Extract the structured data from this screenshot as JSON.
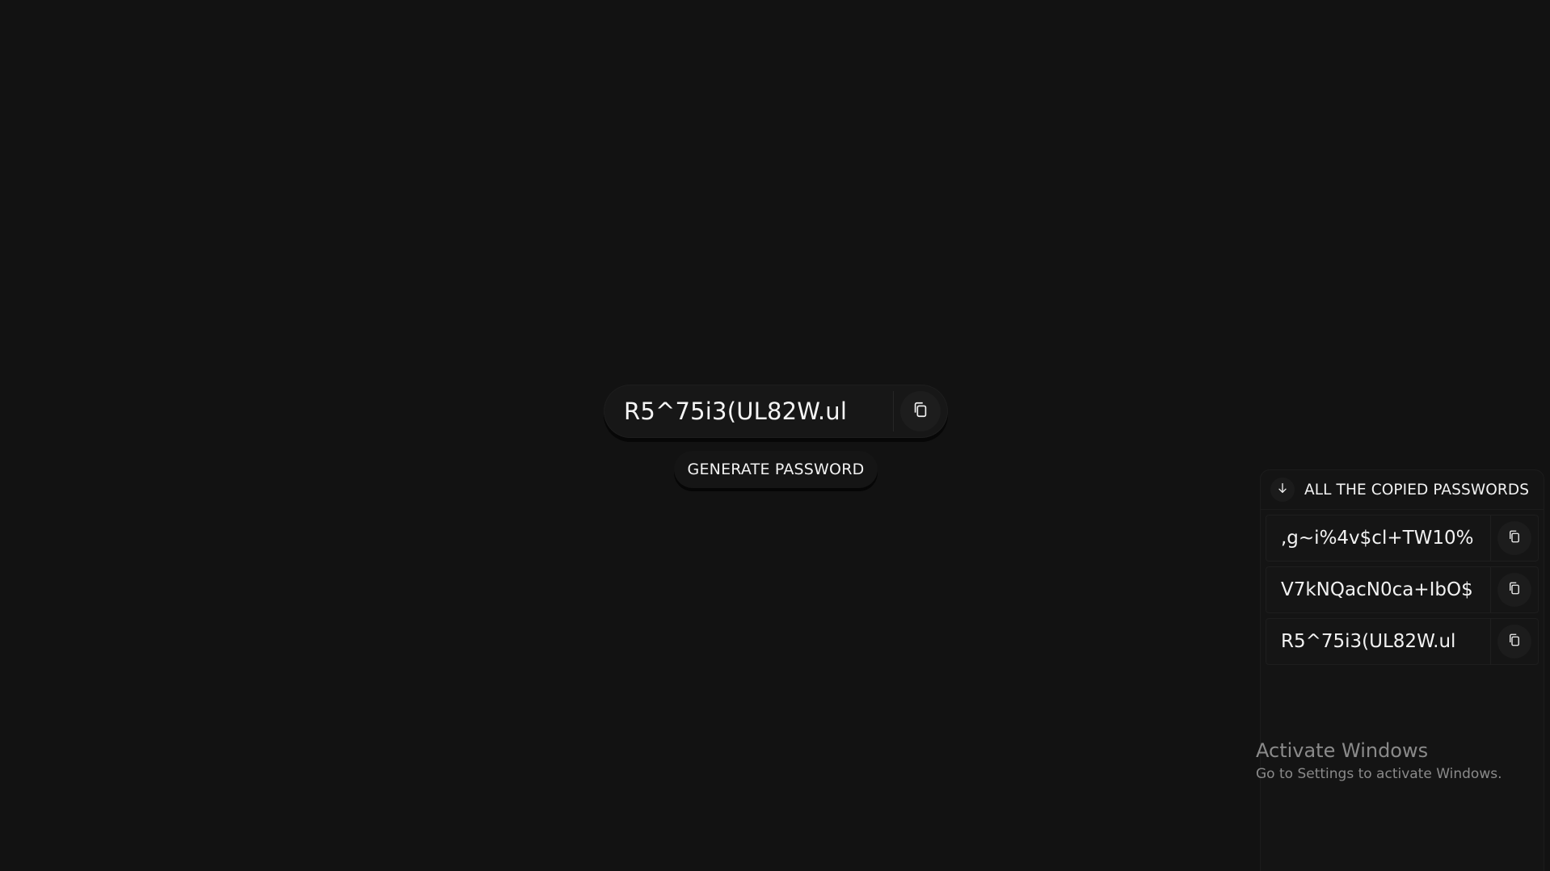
{
  "main": {
    "password": "R5^75i3(UL82W.ul",
    "generate_label": "GENERATE PASSWORD"
  },
  "panel": {
    "title": "ALL THE COPIED PASSWORDS",
    "items": [
      {
        "password": ",g~i%4v$cl+TW10%"
      },
      {
        "password": "V7kNQacN0ca+IbO$"
      },
      {
        "password": "R5^75i3(UL82W.ul"
      }
    ]
  },
  "watermark": {
    "title": "Activate Windows",
    "subtitle": "Go to Settings to activate Windows."
  },
  "icons": {
    "copy": "copy-icon",
    "arrow": "arrow-down-icon"
  },
  "colors": {
    "background": "#121212",
    "text": "#f2f2f2",
    "watermark": "#8a8a8a"
  }
}
